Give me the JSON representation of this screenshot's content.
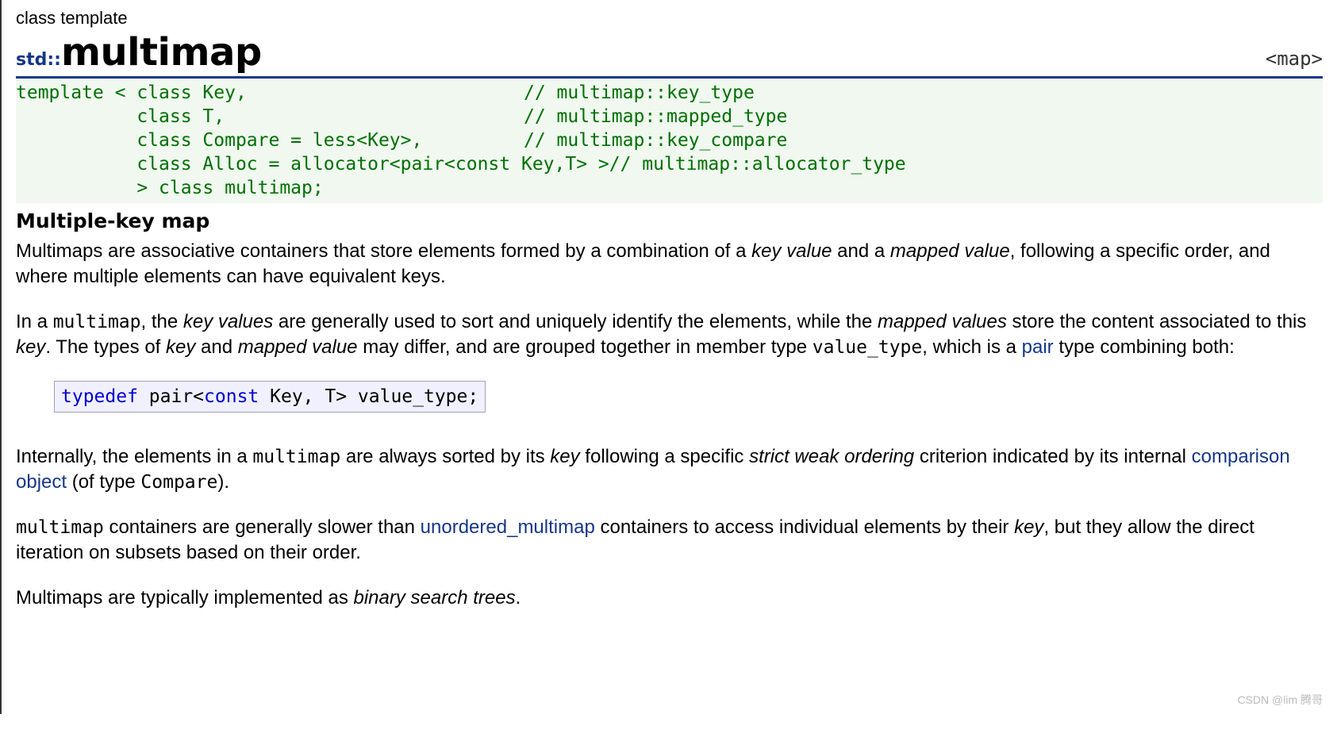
{
  "header": {
    "kind": "class template",
    "namespace": "std::",
    "name": "multimap",
    "include": "<map>"
  },
  "synopsis": {
    "l1a": "template < class Key,",
    "l1b": "// multimap::key_type",
    "l2a": "           class T,",
    "l2b": "// multimap::mapped_type",
    "l3a": "           class Compare = less<Key>,",
    "l3b": "// multimap::key_compare",
    "l4a": "           class Alloc = allocator<pair<const Key,T> >",
    "l4b": "// multimap::allocator_type",
    "l5": "           > class multimap;"
  },
  "section_title": "Multiple-key map",
  "p1": {
    "t1": "Multimaps are associative containers that store elements formed by a combination of a ",
    "kv": "key value",
    "t2": " and a ",
    "mv": "mapped value",
    "t3": ", following a specific order, and where multiple elements can have equivalent keys."
  },
  "p2": {
    "t1": "In a ",
    "m1": "multimap",
    "t2": ", the ",
    "kv": "key values",
    "t3": " are generally used to sort and uniquely identify the elements, while the ",
    "mv": "mapped values",
    "t4": " store the content associated to this ",
    "key": "key",
    "t5": ". The types of ",
    "key2": "key",
    "t6": " and ",
    "mv2": "mapped value",
    "t7": " may differ, and are grouped together in member type ",
    "vt": "value_type",
    "t8": ", which is a ",
    "pair": "pair",
    "t9": " type combining both:"
  },
  "typedef_code": {
    "kw1": "typedef",
    "mid": " pair<",
    "kw2": "const",
    "rest": " Key, T> value_type;"
  },
  "p3": {
    "t1": "Internally, the elements in a ",
    "m1": "multimap",
    "t2": " are always sorted by its ",
    "key": "key",
    "t3": " following a specific ",
    "swo": "strict weak ordering",
    "t4": " criterion indicated by its internal ",
    "comp": "comparison object",
    "t5": " (of type ",
    "cmpt": "Compare",
    "t6": ")."
  },
  "p4": {
    "m1": "multimap",
    "t1": " containers are generally slower than ",
    "umm": "unordered_multimap",
    "t2": " containers to access individual elements by their ",
    "key": "key",
    "t3": ", but they allow the direct iteration on subsets based on their order."
  },
  "p5": {
    "t1": "Multimaps are typically implemented as ",
    "bst": "binary search trees",
    "t2": "."
  },
  "watermark": "CSDN @lim 腾哥"
}
